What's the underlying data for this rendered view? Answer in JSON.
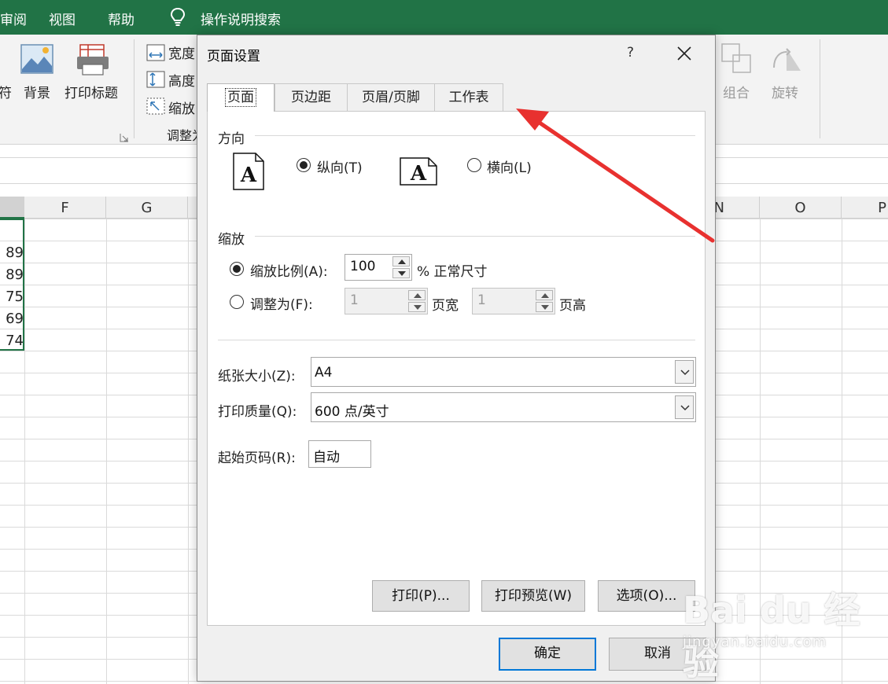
{
  "excel": {
    "menu": [
      "审阅",
      "视图",
      "帮助"
    ],
    "search_label": "操作说明搜索",
    "ribbon": {
      "left_cut_label": "符",
      "background_label": "背景",
      "print_titles_label": "打印标题",
      "width_label": "宽度",
      "height_label": "高度",
      "scale_label": "缩放",
      "group_label": "调整为",
      "combine_label": "组合",
      "rotate_label": "旋转"
    },
    "columns": [
      "F",
      "G",
      "N",
      "O",
      "P"
    ],
    "cell_values": [
      "89",
      "89",
      "75",
      "69",
      "74"
    ]
  },
  "dialog": {
    "title": "页面设置",
    "help": "?",
    "tabs": [
      {
        "label": "页面",
        "active": true
      },
      {
        "label": "页边距",
        "active": false
      },
      {
        "label": "页眉/页脚",
        "active": false
      },
      {
        "label": "工作表",
        "active": false
      }
    ],
    "orientation": {
      "section": "方向",
      "portrait": "纵向(T)",
      "landscape": "横向(L)",
      "selected": "portrait"
    },
    "scaling": {
      "section": "缩放",
      "adjust_label": "缩放比例(A):",
      "adjust_value": "100",
      "adjust_suffix": "% 正常尺寸",
      "fit_label": "调整为(F):",
      "fit_wide_value": "1",
      "fit_wide_suffix": "页宽",
      "fit_tall_value": "1",
      "fit_tall_suffix": "页高",
      "selected": "adjust"
    },
    "paper_size": {
      "label": "纸张大小(Z):",
      "value": "A4"
    },
    "print_quality": {
      "label": "打印质量(Q):",
      "value": "600 点/英寸"
    },
    "first_page": {
      "label": "起始页码(R):",
      "value": "自动"
    },
    "buttons": {
      "print": "打印(P)...",
      "preview": "打印预览(W)",
      "options": "选项(O)...",
      "ok": "确定",
      "cancel": "取消"
    }
  },
  "annotation": {
    "arrow_color": "#e8312f"
  },
  "watermark": {
    "line1": "Bai du 经验",
    "line2": "jingyan.baidu.com"
  },
  "colors": {
    "excel_green": "#217346",
    "focus_blue": "#0078d7"
  }
}
